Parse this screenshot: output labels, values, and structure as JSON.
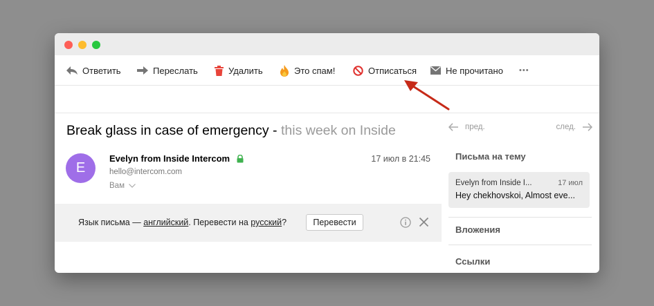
{
  "toolbar": {
    "reply": "Ответить",
    "forward": "Переслать",
    "delete": "Удалить",
    "spam": "Это спам!",
    "unsubscribe": "Отписаться",
    "unread": "Не прочитано",
    "more": "•••"
  },
  "message": {
    "subject_main": "Break glass in case of emergency - ",
    "subject_fade": "this week on Inside",
    "avatar_letter": "E",
    "sender_name": "Evelyn from Inside Intercom",
    "sender_email": "hello@intercom.com",
    "recipient": "Вам",
    "date": "17 июл в 21:45"
  },
  "translate": {
    "prefix": "Язык письма — ",
    "language": "английский",
    "middle": ". Перевести на ",
    "target": "русский",
    "suffix": "?",
    "button": "Перевести"
  },
  "sidebar": {
    "prev": "пред.",
    "next": "след.",
    "thread_heading": "Письма на тему",
    "thread": {
      "from": "Evelyn from Inside I...",
      "date": "17 июл",
      "snippet": "Hey chekhovskoi, Almost eve..."
    },
    "attachments": "Вложения",
    "links": "Ссылки"
  },
  "colors": {
    "accent_red": "#c62a18",
    "avatar": "#9f6ee8",
    "lock_green": "#3fb24f",
    "trash_red": "#e8443a",
    "fire_orange": "#f59b1c"
  }
}
